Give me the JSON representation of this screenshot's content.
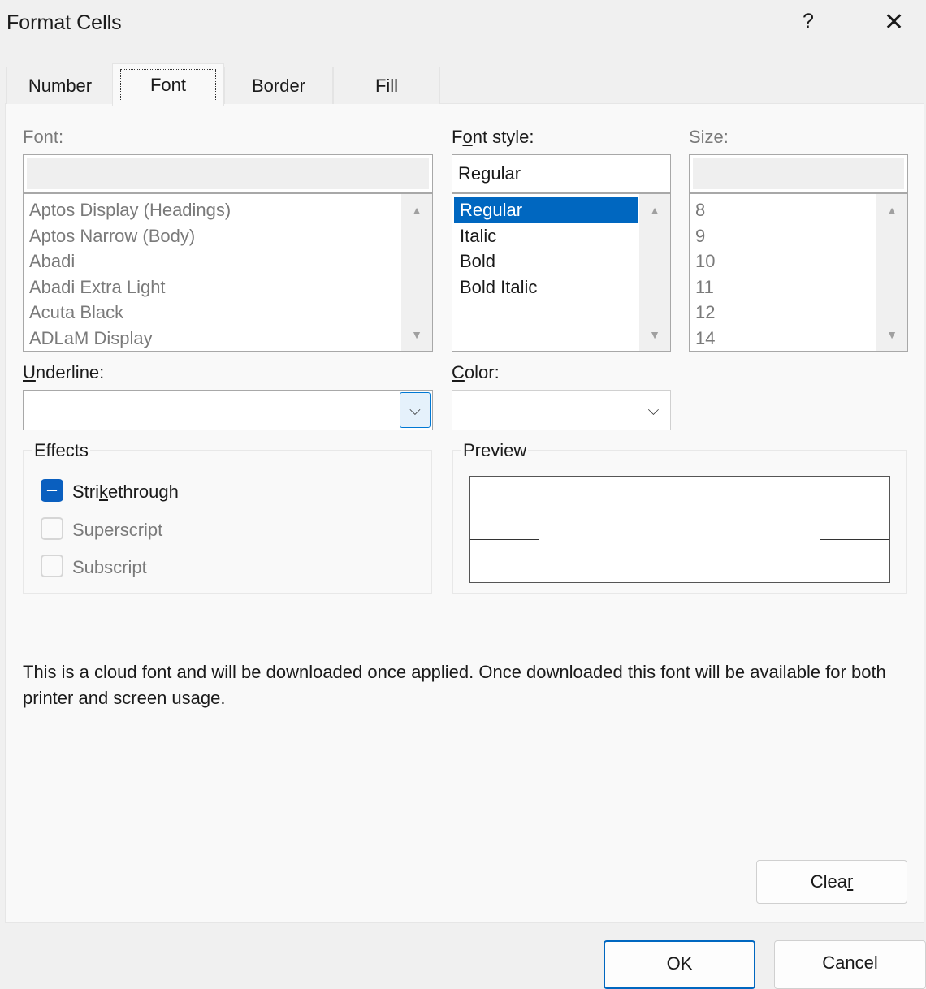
{
  "window": {
    "title": "Format Cells",
    "help": "?",
    "close": "✕"
  },
  "tabs": [
    "Number",
    "Font",
    "Border",
    "Fill"
  ],
  "font": {
    "label": "Font:",
    "value": "",
    "items": [
      "Aptos Display (Headings)",
      "Aptos Narrow (Body)",
      "Abadi",
      "Abadi Extra Light",
      "Acuta Black",
      "ADLaM Display"
    ]
  },
  "style": {
    "label_pre": "F",
    "label_u": "o",
    "label_post": "nt style:",
    "value": "Regular",
    "items": [
      "Regular",
      "Italic",
      "Bold",
      "Bold Italic"
    ]
  },
  "size": {
    "label": "Size:",
    "value": "",
    "items": [
      "8",
      "9",
      "10",
      "11",
      "12",
      "14"
    ]
  },
  "underline": {
    "label_u": "U",
    "label_post": "nderline:",
    "value": ""
  },
  "color": {
    "label_u": "C",
    "label_post": "olor:",
    "value": ""
  },
  "effects": {
    "label": "Effects",
    "strike_pre": "Stri",
    "strike_u": "k",
    "strike_post": "ethrough",
    "superscript": "Superscript",
    "subscript": "Subscript",
    "strike_state": "indeterminate"
  },
  "preview": {
    "label": "Preview"
  },
  "info": "This is a cloud font and will be downloaded once applied. Once downloaded this font will be available for both printer and screen usage.",
  "buttons": {
    "clear_pre": "Clea",
    "clear_u": "r",
    "ok": "OK",
    "cancel": "Cancel"
  },
  "colors": {
    "accent": "#0067c0"
  }
}
